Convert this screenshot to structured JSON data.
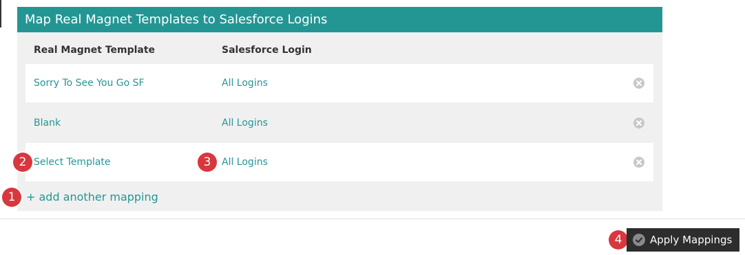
{
  "panel": {
    "title": "Map Real Magnet Templates to Salesforce Logins",
    "columns": {
      "template": "Real Magnet Template",
      "login": "Salesforce Login"
    },
    "rows": [
      {
        "template": "Sorry To See You Go SF",
        "login": "All Logins"
      },
      {
        "template": "Blank",
        "login": "All Logins"
      },
      {
        "template": "Select Template",
        "login": "All Logins"
      }
    ],
    "add_mapping_label": "+ add another mapping"
  },
  "footer": {
    "apply_label": "Apply Mappings"
  },
  "callouts": [
    "1",
    "2",
    "3",
    "4"
  ],
  "colors": {
    "accent": "#239694",
    "badge": "#d9373e",
    "button": "#2d2d2d"
  },
  "icons": {
    "remove": "remove-circle-icon",
    "apply": "check-circle-icon"
  }
}
